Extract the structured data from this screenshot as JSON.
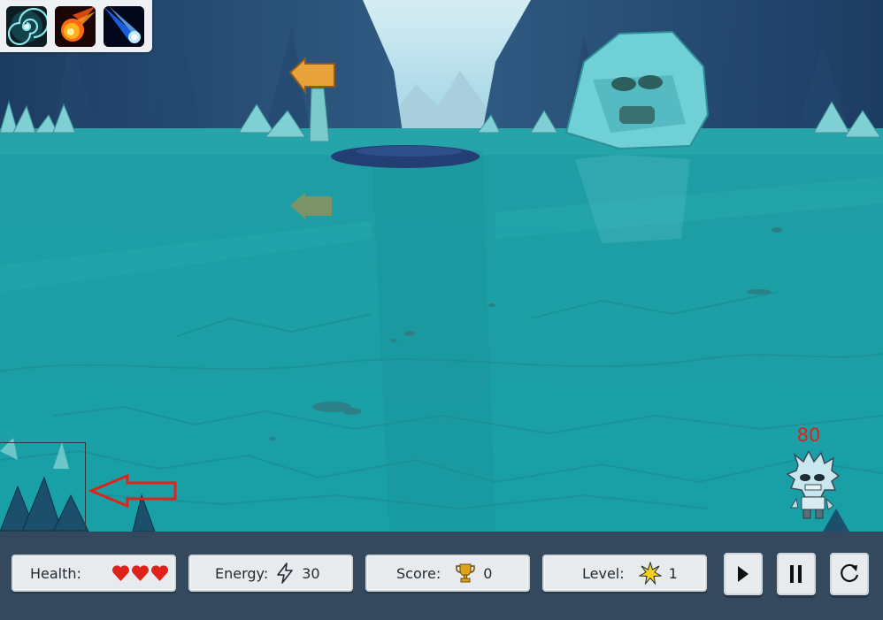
{
  "spells": [
    {
      "name": "vortex-spell-icon"
    },
    {
      "name": "fireball-spell-icon"
    },
    {
      "name": "comet-spell-icon"
    }
  ],
  "enemy": {
    "health": "80"
  },
  "hud": {
    "health_label": "Health:",
    "hearts": 3,
    "energy_label": "Energy:",
    "energy_value": "30",
    "score_label": "Score:",
    "score_value": "0",
    "level_label": "Level:",
    "level_value": "1"
  },
  "colors": {
    "water": "#1aa2a8",
    "hud_background": "#34495e",
    "heart": "#e0231a",
    "arrow": "#e0231a"
  }
}
